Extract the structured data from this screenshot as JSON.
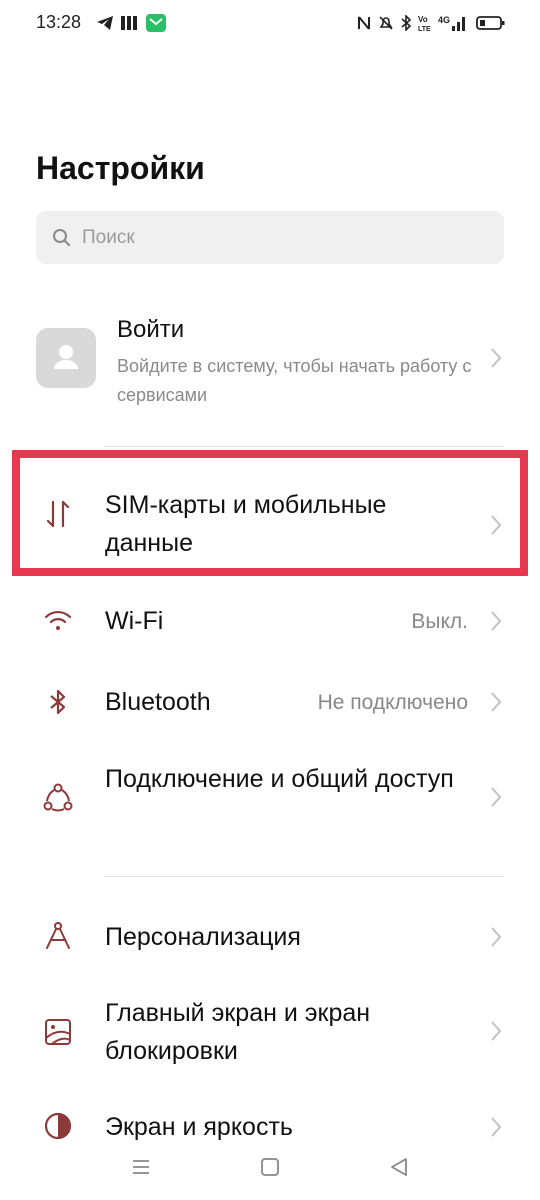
{
  "status_bar": {
    "time": "13:28",
    "network": "4G"
  },
  "page": {
    "title": "Настройки"
  },
  "search": {
    "placeholder": "Поиск"
  },
  "account": {
    "title": "Войти",
    "subtitle": "Войдите в систему, чтобы начать работу с сервисами"
  },
  "items": [
    {
      "label": "SIM-карты и мобильные данные",
      "value": "",
      "icon": "sim-data-arrows-icon"
    },
    {
      "label": "Wi-Fi",
      "value": "Выкл.",
      "icon": "wifi-icon"
    },
    {
      "label": "Bluetooth",
      "value": "Не подключено",
      "icon": "bluetooth-icon"
    },
    {
      "label": "Подключение и общий доступ",
      "value": "",
      "icon": "connection-sharing-icon"
    },
    {
      "label": "Персонализация",
      "value": "",
      "icon": "personalization-compass-icon"
    },
    {
      "label": "Главный экран и экран блокировки",
      "value": "",
      "icon": "home-lock-screen-icon"
    },
    {
      "label": "Экран и яркость",
      "value": "",
      "icon": "display-brightness-icon"
    }
  ],
  "colors": {
    "accent_icon": "#8b3a3a",
    "highlight": "#e8384f"
  }
}
